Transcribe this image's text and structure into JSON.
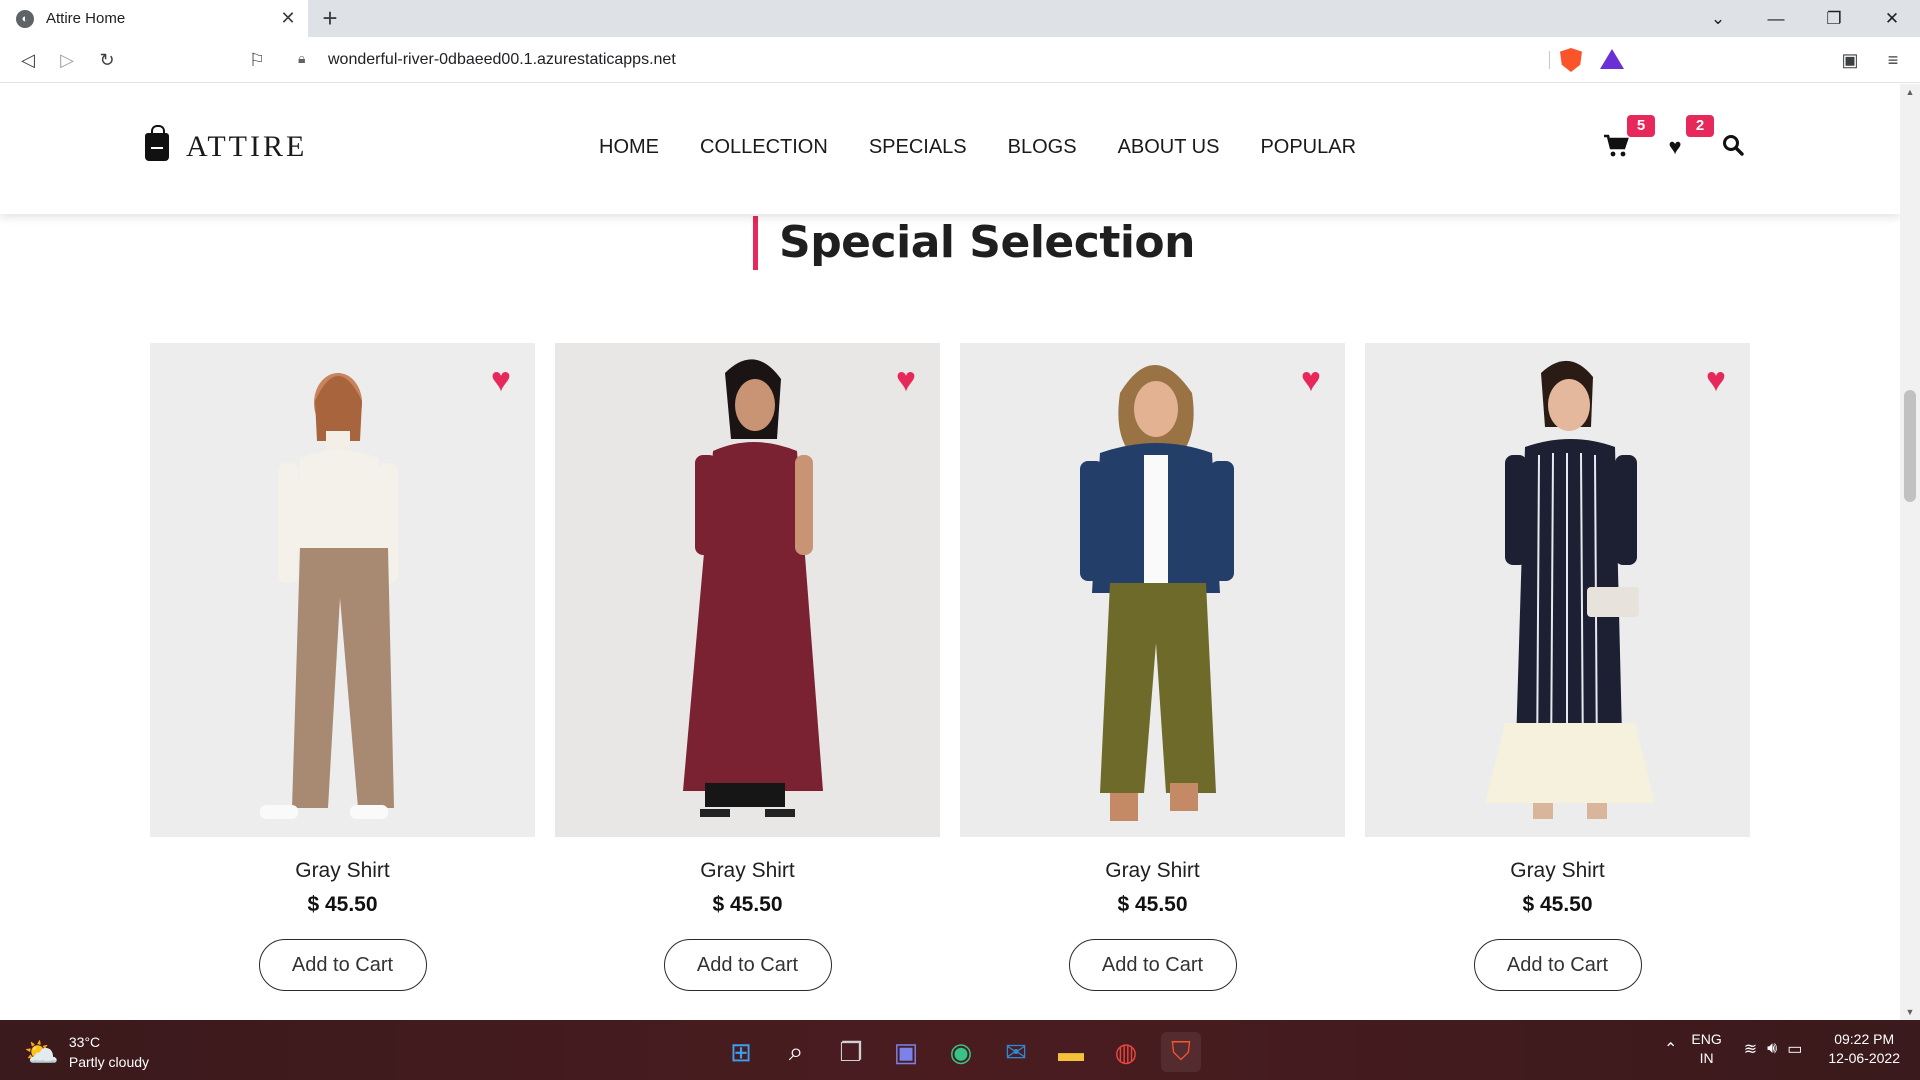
{
  "browser": {
    "tab_title": "Attire Home",
    "new_tab": "+",
    "url": "wonderful-river-0dbaeed00.1.azurestaticapps.net",
    "icons": [
      "back-icon",
      "forward-icon",
      "reload-icon",
      "bookmark-icon",
      "lock-icon",
      "brave-shield-icon",
      "brave-rewards-icon",
      "wallet-icon",
      "menu-icon",
      "tab-search-icon",
      "minimize-icon",
      "maximize-icon",
      "close-icon"
    ]
  },
  "header": {
    "brand": "ATTIRE",
    "nav": [
      "HOME",
      "COLLECTION",
      "SPECIALS",
      "BLOGS",
      "ABOUT US",
      "POPULAR"
    ],
    "cart_count": "5",
    "wishlist_count": "2",
    "accent_color": "#e6285a"
  },
  "section": {
    "title": "Special Selection"
  },
  "products": [
    {
      "name": "Gray Shirt",
      "price": "$ 45.50",
      "button": "Add to Cart"
    },
    {
      "name": "Gray Shirt",
      "price": "$ 45.50",
      "button": "Add to Cart"
    },
    {
      "name": "Gray Shirt",
      "price": "$ 45.50",
      "button": "Add to Cart"
    },
    {
      "name": "Gray Shirt",
      "price": "$ 45.50",
      "button": "Add to Cart"
    }
  ],
  "taskbar": {
    "temperature": "33°C",
    "weather": "Partly cloudy",
    "lang_top": "ENG",
    "lang_bottom": "IN",
    "time": "09:22 PM",
    "date": "12-06-2022"
  }
}
